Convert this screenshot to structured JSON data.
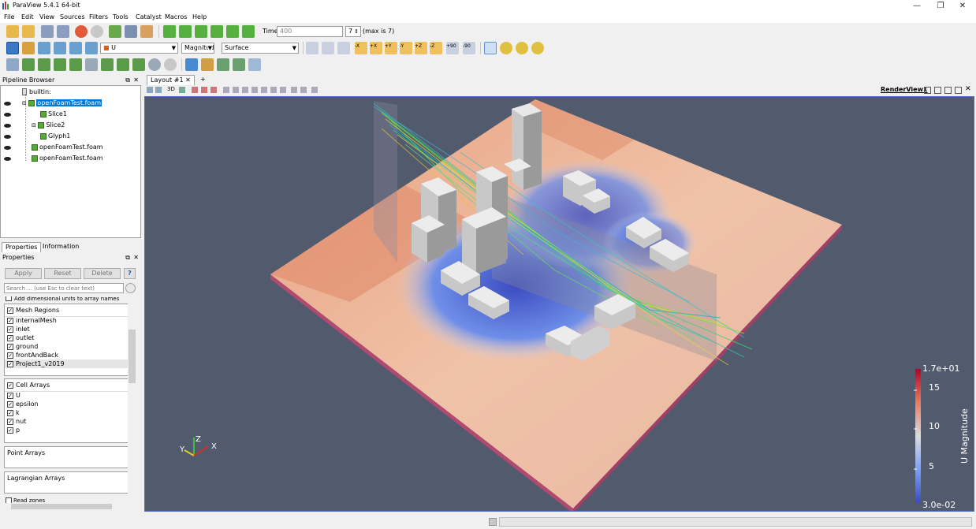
{
  "window": {
    "title": "ParaView 5.4.1 64-bit",
    "min": "—",
    "max": "❐",
    "close": "✕"
  },
  "menu": [
    "File",
    "Edit",
    "View",
    "Sources",
    "Filters",
    "Tools",
    "Catalyst",
    "Macros",
    "Help"
  ],
  "time": {
    "label": "Time:",
    "value": "400",
    "step": "7",
    "max_text": "(max is 7)"
  },
  "toolbar2": {
    "active_var": "U",
    "component": "Magnitude",
    "representation": "Surface",
    "view_labels": [
      "-X",
      "+X",
      "+Y",
      "-Y",
      "+Z",
      "-Z",
      "+90",
      "-90"
    ]
  },
  "pipeline": {
    "title": "Pipeline Browser",
    "items": [
      {
        "label": "builtin:",
        "selected": false,
        "eye": false
      },
      {
        "label": "openFoamTest.foam",
        "selected": true,
        "eye": true
      },
      {
        "label": "Slice1",
        "selected": false,
        "eye": true
      },
      {
        "label": "Slice2",
        "selected": false,
        "eye": true
      },
      {
        "label": "Glyph1",
        "selected": false,
        "eye": true
      },
      {
        "label": "openFoamTest.foam",
        "selected": false,
        "eye": true
      },
      {
        "label": "openFoamTest.foam",
        "selected": false,
        "eye": true
      }
    ]
  },
  "tabs": {
    "properties": "Properties",
    "information": "Information"
  },
  "properties": {
    "title": "Properties",
    "apply": "Apply",
    "reset": "Reset",
    "delete": "Delete",
    "help": "?",
    "search_placeholder": "Search ... (use Esc to clear text)",
    "add_units": "Add dimensional units to array names",
    "mesh_regions_title": "Mesh Regions",
    "mesh_regions": [
      "internalMesh",
      "inlet",
      "outlet",
      "ground",
      "frontAndBack",
      "Project1_v2019"
    ],
    "cell_arrays_title": "Cell Arrays",
    "cell_arrays": [
      "U",
      "epsilon",
      "k",
      "nut",
      "p"
    ],
    "point_arrays": "Point Arrays",
    "lagrangian_arrays": "Lagrangian Arrays",
    "read_zones": "Read zones"
  },
  "layout": {
    "tab": "Layout #1",
    "add": "+",
    "render_view": "RenderView1",
    "mode_3d": "3D"
  },
  "colorbar": {
    "title": "U Magnitude",
    "max_label": "1.7e+01",
    "min_label": "3.0e-02",
    "ticks": [
      "15",
      "10",
      "5"
    ]
  },
  "axes": {
    "x": "X",
    "y": "Y",
    "z": "Z"
  },
  "colors": {
    "accent": "#0078d7",
    "view_bg": "#525a6e",
    "selection": "#0078d7"
  }
}
